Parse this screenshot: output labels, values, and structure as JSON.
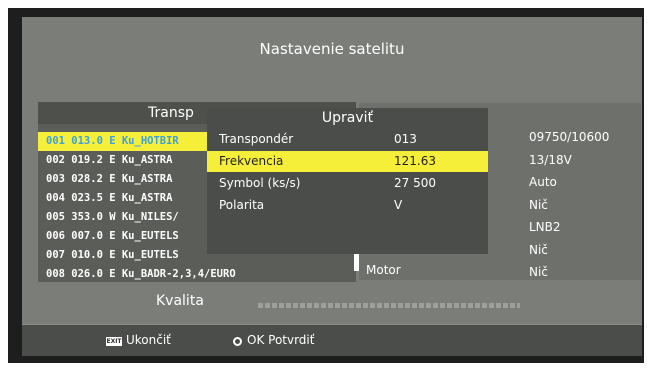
{
  "title": "Nastavenie satelitu",
  "list": {
    "header": "Transp",
    "rows": [
      "001 013.0 E  Ku_HOTBIR",
      "002 019.2 E  Ku_ASTRA",
      "003 028.2 E  Ku_ASTRA",
      "004 023.5 E  Ku_ASTRA",
      "005 353.0 W  Ku_NILES/",
      "006 007.0 E  Ku_EUTELS",
      "007 010.0 E  Ku_EUTELS",
      "008 026.0 E  Ku_BADR-2,3,4/EURO"
    ],
    "selected_index": 0
  },
  "right_values": [
    "09750/10600",
    "13/18V",
    "Auto",
    "Nič",
    "LNB2",
    "Nič",
    "Nič"
  ],
  "motor_label": "Motor",
  "dialog": {
    "title": "Upraviť",
    "rows": [
      {
        "label": "Transpondér",
        "value": "013"
      },
      {
        "label": "Frekvencia",
        "value": "121.63"
      },
      {
        "label": "Symbol (ks/s)",
        "value": "27 500"
      },
      {
        "label": "Polarita",
        "value": "V"
      }
    ],
    "selected_index": 1
  },
  "quality_label": "Kvalita",
  "footer": {
    "exit_key": "EXIT",
    "exit_label": "Ukončiť",
    "ok_label": "OK Potvrdiť"
  },
  "colors": {
    "highlight": "#f6ef3a",
    "selected_list_text": "#3aa0df"
  }
}
